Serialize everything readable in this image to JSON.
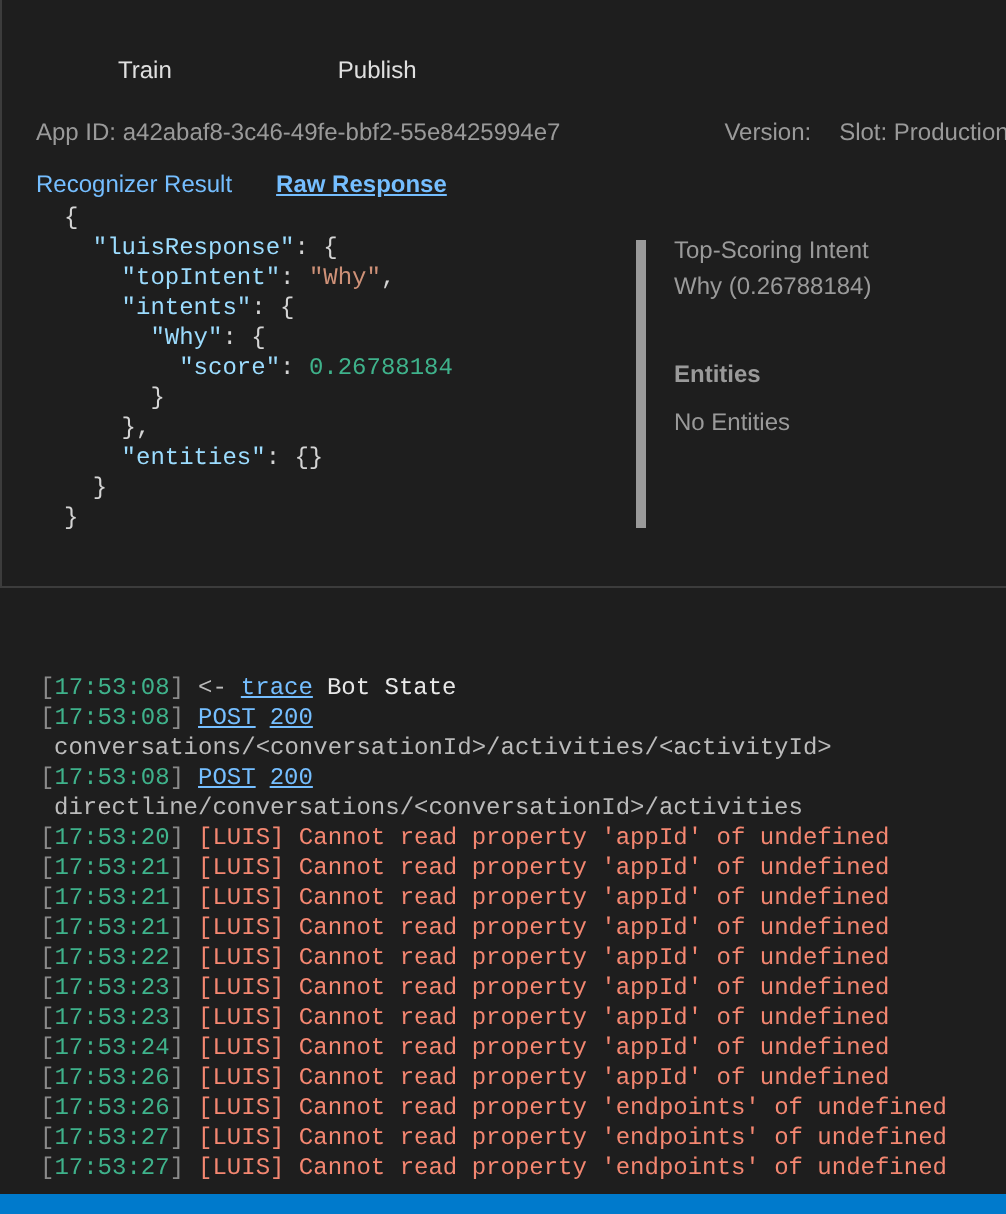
{
  "toolbar": {
    "buttons": [
      "Train",
      "Publish"
    ]
  },
  "app_info": {
    "app_id": "App ID: a42abaf8-3c46-49fe-bbf2-55e8425994e7",
    "version": "Version:",
    "slot": "Slot: Production"
  },
  "tabs": [
    {
      "label": "Recognizer Result",
      "selected": false
    },
    {
      "label": "Raw Response",
      "selected": true
    }
  ],
  "json_view": {
    "lines": [
      [
        {
          "kind": "punct",
          "text": "{"
        }
      ],
      [
        {
          "kind": "key",
          "text": "  \"luisResponse\""
        },
        {
          "kind": "punct",
          "text": ": {"
        }
      ],
      [
        {
          "kind": "key",
          "text": "    \"topIntent\""
        },
        {
          "kind": "punct",
          "text": ": "
        },
        {
          "kind": "string",
          "text": "\"Why\""
        },
        {
          "kind": "punct",
          "text": ","
        }
      ],
      [
        {
          "kind": "key",
          "text": "    \"intents\""
        },
        {
          "kind": "punct",
          "text": ": {"
        }
      ],
      [
        {
          "kind": "key",
          "text": "      \"Why\""
        },
        {
          "kind": "punct",
          "text": ": {"
        }
      ],
      [
        {
          "kind": "key",
          "text": "        \"score\""
        },
        {
          "kind": "punct",
          "text": ": "
        },
        {
          "kind": "number",
          "text": "0.26788184"
        }
      ],
      [
        {
          "kind": "punct",
          "text": "      }"
        }
      ],
      [
        {
          "kind": "punct",
          "text": "    },"
        }
      ],
      [
        {
          "kind": "key",
          "text": "    \"entities\""
        },
        {
          "kind": "punct",
          "text": ": {}"
        }
      ],
      [
        {
          "kind": "punct",
          "text": "  }"
        }
      ],
      [
        {
          "kind": "punct",
          "text": "}"
        }
      ]
    ]
  },
  "summary": {
    "intent_heading": "Top-Scoring Intent",
    "intent_value": "Why (0.26788184)",
    "entities_heading": "Entities",
    "entities_value": "No Entities"
  },
  "log": [
    {
      "kind": "trace",
      "time": "[17:53:08]",
      "arrow": "<-",
      "link": "trace",
      "text": "Bot State"
    },
    {
      "kind": "request",
      "time": "[17:53:08]",
      "method": "POST",
      "status": "200",
      "path": "conversations/<conversationId>/activities/<activityId>"
    },
    {
      "kind": "request",
      "time": "[17:53:08]",
      "method": "POST",
      "status": "200",
      "path": "directline/conversations/<conversationId>/activities"
    },
    {
      "kind": "error",
      "time": "[17:53:20]",
      "text": "[LUIS] Cannot read property 'appId' of undefined"
    },
    {
      "kind": "error",
      "time": "[17:53:21]",
      "text": "[LUIS] Cannot read property 'appId' of undefined"
    },
    {
      "kind": "error",
      "time": "[17:53:21]",
      "text": "[LUIS] Cannot read property 'appId' of undefined"
    },
    {
      "kind": "error",
      "time": "[17:53:21]",
      "text": "[LUIS] Cannot read property 'appId' of undefined"
    },
    {
      "kind": "error",
      "time": "[17:53:22]",
      "text": "[LUIS] Cannot read property 'appId' of undefined"
    },
    {
      "kind": "error",
      "time": "[17:53:23]",
      "text": "[LUIS] Cannot read property 'appId' of undefined"
    },
    {
      "kind": "error",
      "time": "[17:53:23]",
      "text": "[LUIS] Cannot read property 'appId' of undefined"
    },
    {
      "kind": "error",
      "time": "[17:53:24]",
      "text": "[LUIS] Cannot read property 'appId' of undefined"
    },
    {
      "kind": "error",
      "time": "[17:53:26]",
      "text": "[LUIS] Cannot read property 'appId' of undefined"
    },
    {
      "kind": "error",
      "time": "[17:53:26]",
      "text": "[LUIS] Cannot read property 'endpoints' of undefined"
    },
    {
      "kind": "error",
      "time": "[17:53:27]",
      "text": "[LUIS] Cannot read property 'endpoints' of undefined"
    },
    {
      "kind": "error",
      "time": "[17:53:27]",
      "text": "[LUIS] Cannot read property 'endpoints' of undefined"
    }
  ]
}
